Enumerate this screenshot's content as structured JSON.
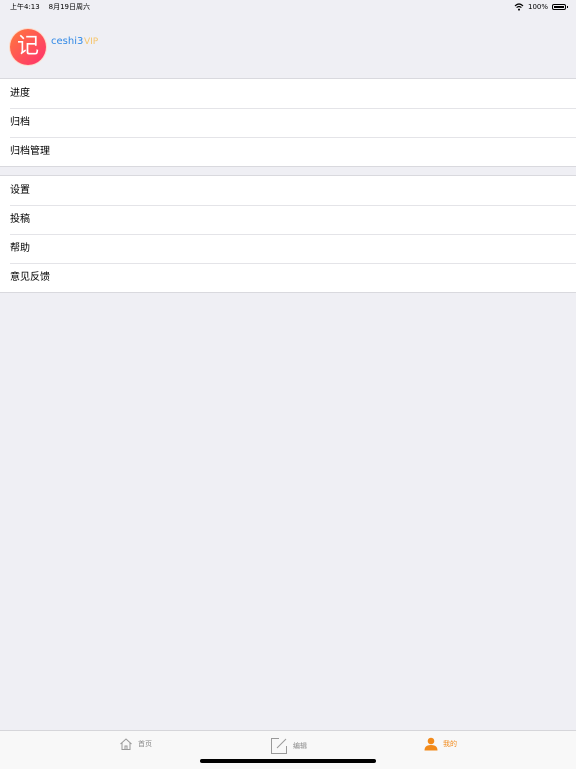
{
  "status": {
    "time": "上午4:13",
    "date": "8月19日周六",
    "battery": "100%"
  },
  "profile": {
    "avatar_char": "记",
    "username": "ceshi3",
    "badge": "VIP"
  },
  "menu": {
    "group1": [
      "进度",
      "归档",
      "归档管理"
    ],
    "group2": [
      "设置",
      "投稿",
      "帮助",
      "意见反馈"
    ]
  },
  "tabs": [
    {
      "label": "首页",
      "icon": "home-icon",
      "active": false
    },
    {
      "label": "编辑",
      "icon": "edit-icon",
      "active": false
    },
    {
      "label": "我的",
      "icon": "person-icon",
      "active": true
    }
  ],
  "colors": {
    "accent": "#f28a1a",
    "link": "#2f88e6",
    "vip": "#f6c56a"
  }
}
